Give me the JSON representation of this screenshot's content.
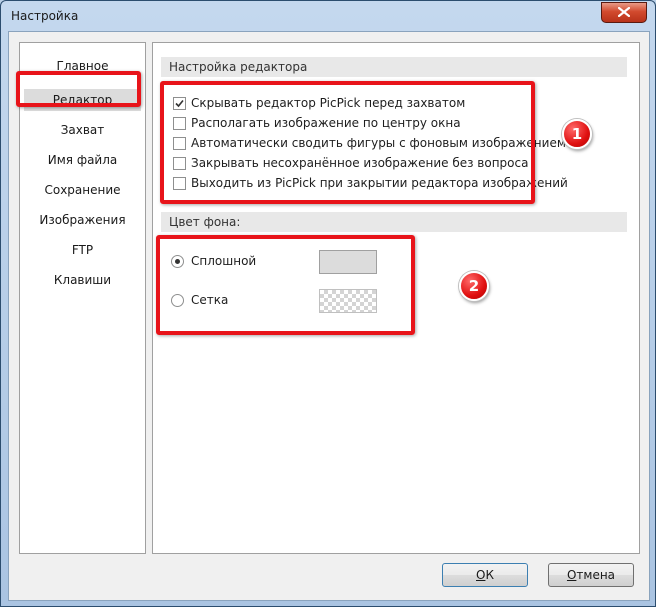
{
  "window": {
    "title": "Настройка"
  },
  "sidebar": {
    "items": [
      {
        "label": "Главное",
        "selected": false
      },
      {
        "label": "Редактор",
        "selected": true
      },
      {
        "label": "Захват",
        "selected": false
      },
      {
        "label": "Имя файла",
        "selected": false
      },
      {
        "label": "Сохранение",
        "selected": false
      },
      {
        "label": "Изображения",
        "selected": false
      },
      {
        "label": "FTP",
        "selected": false
      },
      {
        "label": "Клавиши",
        "selected": false
      }
    ]
  },
  "editor_settings": {
    "header": "Настройка редактора",
    "options": [
      {
        "label": "Скрывать редактор PicPick перед захватом",
        "checked": true
      },
      {
        "label": "Располагать изображение по центру окна",
        "checked": false
      },
      {
        "label": "Автоматически сводить фигуры с фоновым изображением",
        "checked": false
      },
      {
        "label": "Закрывать несохранённое изображение без вопроса",
        "checked": false
      },
      {
        "label": "Выходить из PicPick при закрытии редактора изображений",
        "checked": false
      }
    ]
  },
  "background": {
    "header": "Цвет фона:",
    "options": [
      {
        "label": "Сплошной",
        "selected": true
      },
      {
        "label": "Сетка",
        "selected": false
      }
    ],
    "solid_color": "#dcdcdc"
  },
  "annotations": {
    "badge1": "1",
    "badge2": "2",
    "highlight_color": "#e8141a"
  },
  "buttons": {
    "ok_mnemonic": "О",
    "ok_rest": "К",
    "cancel_mnemonic": "О",
    "cancel_rest": "тмена"
  },
  "icons": {
    "close": "close-icon",
    "check": "checkmark-icon"
  }
}
